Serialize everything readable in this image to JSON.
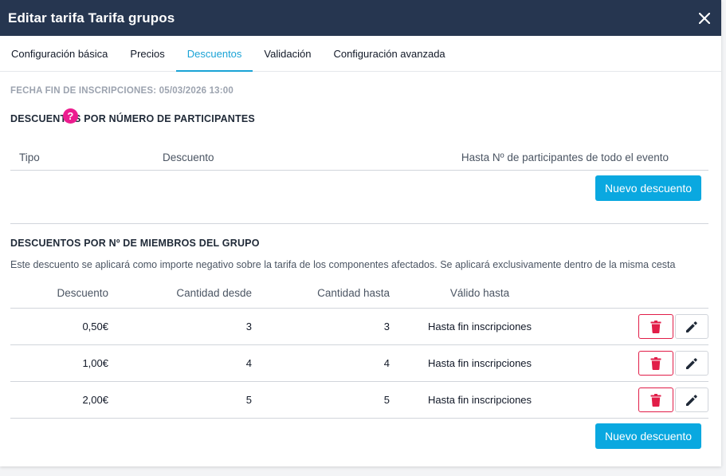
{
  "header": {
    "title": "Editar tarifa Tarifa grupos",
    "close_icon": "close-icon"
  },
  "tabs": [
    {
      "label": "Configuración básica",
      "active": false
    },
    {
      "label": "Precios",
      "active": false
    },
    {
      "label": "Descuentos",
      "active": true
    },
    {
      "label": "Validación",
      "active": false
    },
    {
      "label": "Configuración avanzada",
      "active": false
    }
  ],
  "fecha_fin": "FECHA FIN DE INSCRIPCIONES: 05/03/2026 13:00",
  "section_participants": {
    "title": "DESCUENTOS POR NÚMERO DE PARTICIPANTES",
    "help_glyph": "?",
    "columns": [
      "Tipo",
      "Descuento",
      "Hasta Nº de participantes de todo el evento"
    ],
    "new_button": "Nuevo descuento"
  },
  "section_group": {
    "title": "DESCUENTOS POR Nº DE MIEMBROS DEL GRUPO",
    "description": "Este descuento se aplicará como importe negativo sobre la tarifa de los componentes afectados. Se aplicará exclusivamente dentro de la misma cesta",
    "columns": [
      "Descuento",
      "Cantidad desde",
      "Cantidad hasta",
      "Válido hasta"
    ],
    "rows": [
      {
        "descuento": "0,50€",
        "desde": "3",
        "hasta": "3",
        "valido": "Hasta fin inscripciones"
      },
      {
        "descuento": "1,00€",
        "desde": "4",
        "hasta": "4",
        "valido": "Hasta fin inscripciones"
      },
      {
        "descuento": "2,00€",
        "desde": "5",
        "hasta": "5",
        "valido": "Hasta fin inscripciones"
      }
    ],
    "new_button": "Nuevo descuento"
  },
  "colors": {
    "header_bg": "#263650",
    "accent": "#1aa3d6",
    "button": "#0aa8e0",
    "danger": "#e11d48",
    "help": "#ec1d8f"
  }
}
